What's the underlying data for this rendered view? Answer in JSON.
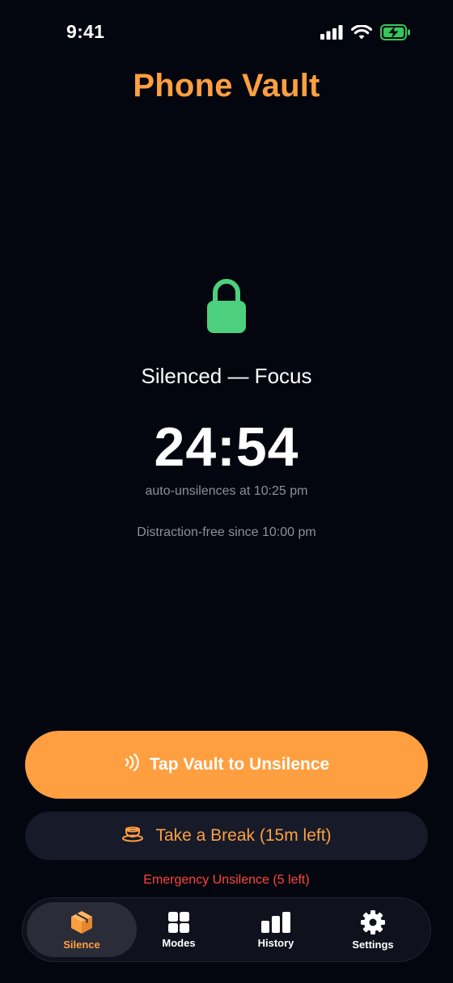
{
  "status_bar": {
    "time": "9:41",
    "icons": [
      "cellular-signal-icon",
      "wifi-icon",
      "battery-charging-icon"
    ]
  },
  "app": {
    "title": "Phone Vault"
  },
  "session": {
    "icon": "lock-icon",
    "status": "Silenced — Focus",
    "timer": "24:54",
    "auto_unsilence": "auto-unsilences at 10:25 pm",
    "since": "Distraction-free since 10:00 pm"
  },
  "actions": {
    "primary": {
      "icon": "nfc-tap-icon",
      "label": "Tap Vault to Unsilence"
    },
    "secondary": {
      "icon": "coffee-cup-icon",
      "label": "Take a Break (15m left)"
    },
    "emergency": {
      "label": "Emergency Unsilence (5 left)"
    }
  },
  "tabs": [
    {
      "icon": "box-icon",
      "label": "Silence",
      "active": true
    },
    {
      "icon": "grid-icon",
      "label": "Modes",
      "active": false
    },
    {
      "icon": "bar-chart-icon",
      "label": "History",
      "active": false
    },
    {
      "icon": "gear-icon",
      "label": "Settings",
      "active": false
    }
  ],
  "colors": {
    "accent": "#ff9f40",
    "background": "#04060f",
    "lock": "#4cd07d",
    "danger": "#ff453a",
    "secondary_button_bg": "#161a29",
    "tab_bar_bg": "#0f121c",
    "battery": "#34c759"
  }
}
